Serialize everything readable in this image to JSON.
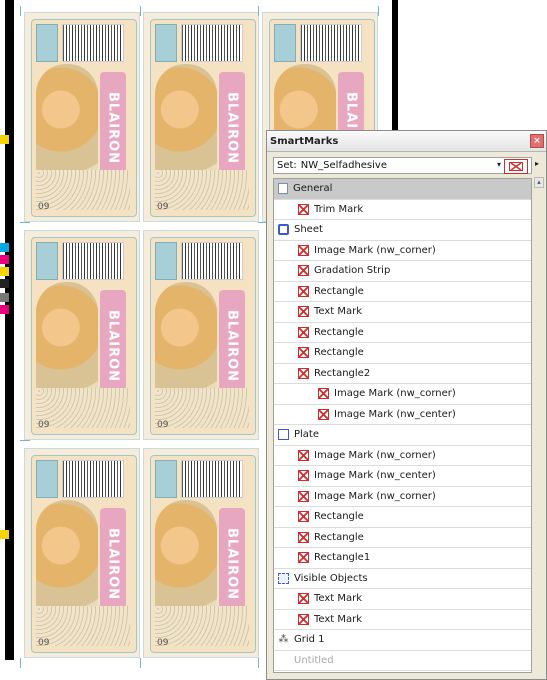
{
  "sheet": {
    "brand_text": "BLAIRON",
    "labels": [
      {
        "num": "09"
      },
      {
        "num": "09"
      },
      {
        "num": "09"
      },
      {
        "num": "09"
      },
      {
        "num": "09"
      },
      {
        "num": "09"
      },
      {
        "num": "09"
      }
    ]
  },
  "panel": {
    "title": "SmartMarks",
    "close": "×",
    "set_label": "Set:",
    "set_value": "NW_Selfadhesive",
    "set_arrow": "▾",
    "set_more": "▸",
    "scroll_up": "▴",
    "tree": [
      {
        "label": "General",
        "indent": 0,
        "icon": "page-icon",
        "selected": true
      },
      {
        "label": "Trim Mark",
        "indent": 1,
        "icon": "mark-icon"
      },
      {
        "label": "Sheet",
        "indent": 0,
        "icon": "sheet-icon"
      },
      {
        "label": "Image Mark (nw_corner)",
        "indent": 1,
        "icon": "mark-icon"
      },
      {
        "label": "Gradation Strip",
        "indent": 1,
        "icon": "mark-icon"
      },
      {
        "label": "Rectangle",
        "indent": 1,
        "icon": "mark-icon"
      },
      {
        "label": "Text Mark",
        "indent": 1,
        "icon": "mark-icon"
      },
      {
        "label": "Rectangle",
        "indent": 1,
        "icon": "mark-icon"
      },
      {
        "label": "Rectangle",
        "indent": 1,
        "icon": "mark-icon"
      },
      {
        "label": "Rectangle2",
        "indent": 1,
        "icon": "mark-icon"
      },
      {
        "label": "Image Mark (nw_corner)",
        "indent": 2,
        "icon": "mark-icon"
      },
      {
        "label": "Image Mark (nw_center)",
        "indent": 2,
        "icon": "mark-icon"
      },
      {
        "label": "Plate",
        "indent": 0,
        "icon": "plate-icon"
      },
      {
        "label": "Image Mark (nw_corner)",
        "indent": 1,
        "icon": "mark-icon"
      },
      {
        "label": "Image Mark (nw_center)",
        "indent": 1,
        "icon": "mark-icon"
      },
      {
        "label": "Image Mark (nw_corner)",
        "indent": 1,
        "icon": "mark-icon"
      },
      {
        "label": "Rectangle",
        "indent": 1,
        "icon": "mark-icon"
      },
      {
        "label": "Rectangle",
        "indent": 1,
        "icon": "mark-icon"
      },
      {
        "label": "Rectangle1",
        "indent": 1,
        "icon": "mark-icon"
      },
      {
        "label": "Visible Objects",
        "indent": 0,
        "icon": "visible-objects-icon"
      },
      {
        "label": "Text Mark",
        "indent": 1,
        "icon": "mark-icon"
      },
      {
        "label": "Text Mark",
        "indent": 1,
        "icon": "mark-icon"
      },
      {
        "label": "Grid 1",
        "indent": 0,
        "icon": "grid-icon"
      },
      {
        "label": "Untitled",
        "indent": 0,
        "icon": "none",
        "dim": true
      }
    ]
  },
  "colors": {
    "mark_red": "#d22b2b",
    "sheet_blue": "#3a5cc8",
    "selected_row": "#c9c9c9",
    "panel_bg": "#ece9d8"
  }
}
